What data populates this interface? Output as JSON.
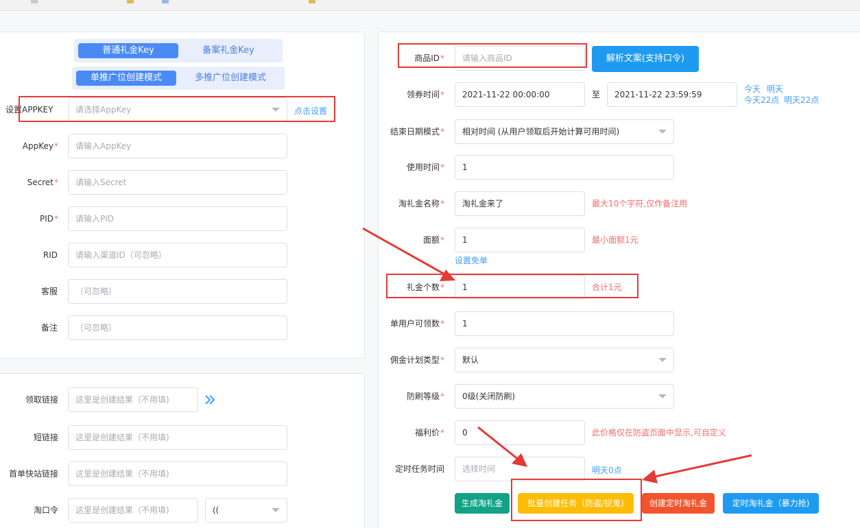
{
  "left_card": {
    "key_tabs": [
      "普通礼金Key",
      "备案礼金Key"
    ],
    "mode_tabs": [
      "单推广位创建模式",
      "多推广位创建模式"
    ],
    "appkey_setting": {
      "label": "设置APPKEY",
      "placeholder": "请选择AppKey",
      "action": "点击设置"
    },
    "fields": [
      {
        "label": "AppKey",
        "required": "*",
        "placeholder": "请输入AppKey"
      },
      {
        "label": "Secret",
        "required": "*",
        "placeholder": "请输入Secret"
      },
      {
        "label": "PID",
        "required": "*",
        "placeholder": "请输入PID"
      },
      {
        "label": "RID",
        "required": "",
        "placeholder": "请输入渠道ID（可忽略）"
      },
      {
        "label": "客服",
        "required": "",
        "placeholder": "（可忽略）"
      },
      {
        "label": "备注",
        "required": "",
        "placeholder": "（可忽略）"
      }
    ]
  },
  "result_card": {
    "rows": [
      {
        "label": "领取链接",
        "placeholder": "这里是创建结果（不用填)"
      },
      {
        "label": "短链接",
        "placeholder": "这里是创建结果（不用填)"
      },
      {
        "label": "首单快站链接",
        "placeholder": "这里是创建结果（不用填)"
      },
      {
        "label": "淘口令",
        "placeholder": "这里是创建结果（不用填)"
      }
    ],
    "expand_icon": "double-chevron-right-icon",
    "kouling_select": "(("
  },
  "right_card": {
    "product_id": {
      "label": "商品ID",
      "required": "*",
      "placeholder": "请输入商品ID"
    },
    "parse_button": "解析文案(支持口令)",
    "coupon_time": {
      "label": "领券时间",
      "required": "*",
      "start": "2021-11-22 00:00:00",
      "sep": "至",
      "end": "2021-11-22 23:59:59",
      "quick": [
        "今天",
        "明天",
        "今天22点",
        "明天22点"
      ]
    },
    "end_mode": {
      "label": "结束日期模式",
      "required": "*",
      "value": "相对时间 (从用户领取后开始计算可用时间)"
    },
    "use_time": {
      "label": "使用时间",
      "required": "*",
      "value": "1"
    },
    "name": {
      "label": "淘礼金名称",
      "required": "*",
      "value": "淘礼金来了",
      "hint": "最大10个字符,仅作备注用"
    },
    "amount": {
      "label": "面额",
      "required": "*",
      "value": "1",
      "hint": "最小面额1元",
      "link": "设置免单"
    },
    "count": {
      "label": "礼金个数",
      "required": "*",
      "value": "1",
      "hint": "合计1元"
    },
    "per_user": {
      "label": "单用户可领数",
      "required": "*",
      "value": "1"
    },
    "plan_type": {
      "label": "佣金计划类型",
      "required": "*",
      "value": "默认"
    },
    "anti_fraud": {
      "label": "防刷等级",
      "required": "*",
      "value": "0级(关闭防刷)"
    },
    "welfare_price": {
      "label": "福利价",
      "required": "*",
      "value": "0",
      "hint": "此价格仅在防盗页面中显示,可自定义"
    },
    "schedule": {
      "label": "定时任务时间",
      "placeholder": "选择时间",
      "link": "明天0点"
    },
    "buttons": [
      "生成淘礼金",
      "批量创建任务（防盗/捉鬼)",
      "创建定时淘礼金",
      "定时淘礼金（暴力抢)"
    ]
  },
  "colors": {
    "accent_blue": "#1e9bf0",
    "annotation_red": "#e53935",
    "hint_red": "#f56c6c",
    "teal": "#13a286",
    "yellow": "#fdbc06",
    "orange": "#f2542d"
  }
}
